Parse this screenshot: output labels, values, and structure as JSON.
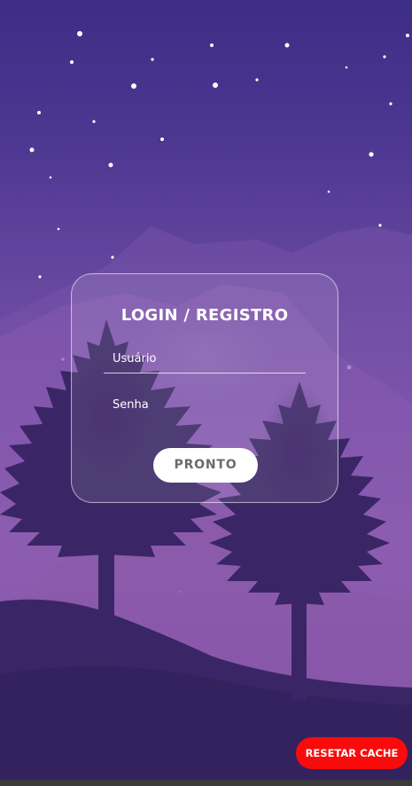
{
  "login": {
    "title": "LOGIN / REGISTRO",
    "username_label": "Usuário",
    "password_label": "Senha",
    "submit_label": "PRONTO"
  },
  "reset_cache": {
    "label": "RESETAR CACHE"
  },
  "colors": {
    "accent_reset": "#f90b0b",
    "button_bg": "#ffffff",
    "button_text": "#6b6b6b",
    "tree": "#3a2666"
  }
}
